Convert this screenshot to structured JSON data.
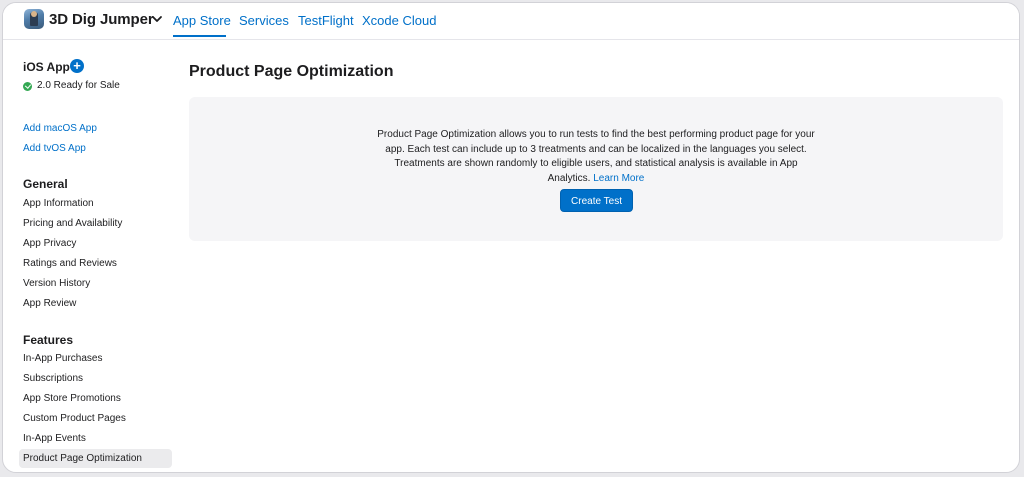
{
  "app": {
    "name": "3D Dig Jumper"
  },
  "nav": {
    "tabs": [
      {
        "label": "App Store",
        "active": true
      },
      {
        "label": "Services",
        "active": false
      },
      {
        "label": "TestFlight",
        "active": false
      },
      {
        "label": "Xcode Cloud",
        "active": false
      }
    ]
  },
  "sidebar": {
    "platform_title": "iOS App",
    "status": "2.0 Ready for Sale",
    "add_links": [
      "Add macOS App",
      "Add tvOS App"
    ],
    "general": {
      "heading": "General",
      "items": [
        "App Information",
        "Pricing and Availability",
        "App Privacy",
        "Ratings and Reviews",
        "Version History",
        "App Review"
      ]
    },
    "features": {
      "heading": "Features",
      "items": [
        "In-App Purchases",
        "Subscriptions",
        "App Store Promotions",
        "Custom Product Pages",
        "In-App Events",
        "Product Page Optimization"
      ],
      "selected": "Product Page Optimization"
    }
  },
  "main": {
    "title": "Product Page Optimization",
    "description": "Product Page Optimization allows you to run tests to find the best performing product page for your app. Each test can include up to 3 treatments and can be localized in the languages you select. Treatments are shown randomly to eligible users, and statistical analysis is available in App Analytics.",
    "learn_more": "Learn More",
    "create_button": "Create Test"
  },
  "colors": {
    "accent": "#0070c9",
    "success": "#34a853",
    "panel_bg": "#f5f5f7"
  }
}
